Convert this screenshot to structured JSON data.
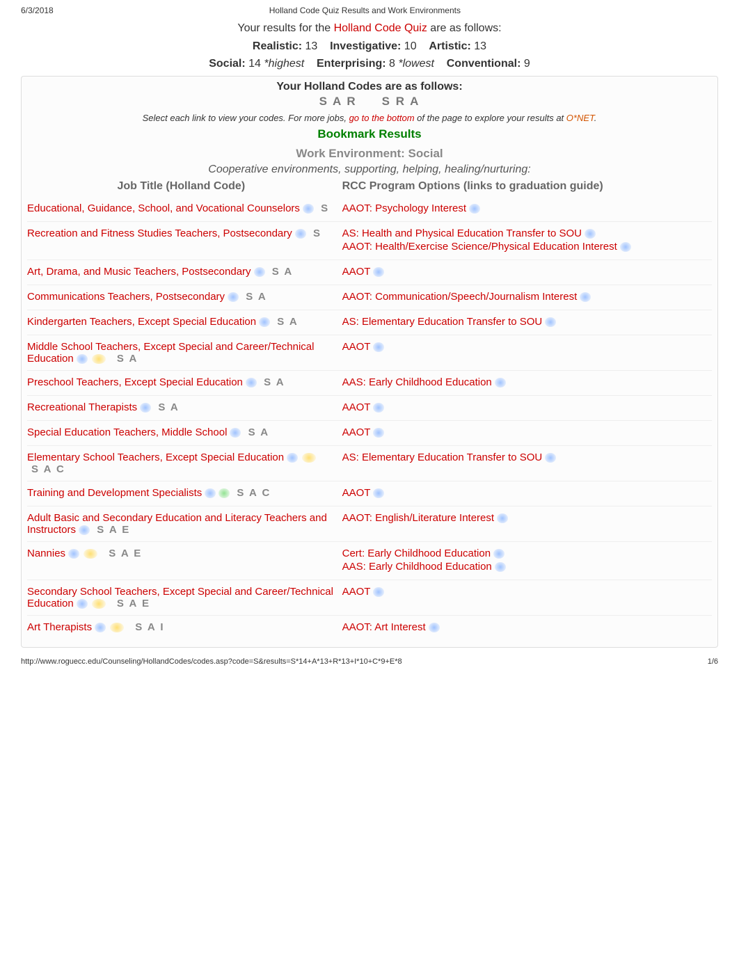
{
  "header": {
    "date": "6/3/2018",
    "title": "Holland Code Quiz Results and Work Environments"
  },
  "intro": {
    "prefix": "Your results for the ",
    "quiz_link": "Holland Code Quiz",
    "suffix": " are as follows:",
    "scores": {
      "realistic_label": "Realistic:",
      "realistic": "13",
      "investigative_label": "Investigative:",
      "investigative": "10",
      "artistic_label": "Artistic:",
      "artistic": "13",
      "social_label": "Social:",
      "social": "14",
      "social_note": "*highest",
      "enterprising_label": "Enterprising:",
      "enterprising": "8",
      "enterprising_note": "*lowest",
      "conventional_label": "Conventional:",
      "conventional": "9"
    }
  },
  "codes": {
    "title": "Your Holland Codes are as follows:",
    "code1": "S A R",
    "code2": "S R A",
    "note_pre": "Select each link to view your codes. For more jobs, ",
    "note_link": "go to the bottom",
    "note_post": " of the page to explore your results at ",
    "note_onet": "O*NET",
    "note_end": "."
  },
  "bookmark": "Bookmark Results",
  "env": {
    "title": "Work Environment: Social",
    "desc": "Cooperative environments, supporting, helping, healing/nurturing:"
  },
  "table_head": {
    "left": "Job Title (Holland Code)",
    "right": "RCC Program Options (links to graduation guide)"
  },
  "rows": [
    {
      "job": "Educational, Guidance, School, and Vocational Counselors",
      "codes": "S",
      "progs": [
        "AAOT: Psychology Interest"
      ]
    },
    {
      "job": "Recreation and Fitness Studies Teachers, Postsecondary",
      "codes": "S",
      "progs": [
        "AS: Health and Physical Education Transfer to SOU",
        "AAOT: Health/Exercise Science/Physical Education Interest"
      ]
    },
    {
      "job": "Art, Drama, and Music Teachers, Postsecondary",
      "codes": "S A",
      "progs": [
        "AAOT"
      ]
    },
    {
      "job": "Communications Teachers, Postsecondary",
      "codes": "S A",
      "progs": [
        "AAOT: Communication/Speech/Journalism Interest"
      ]
    },
    {
      "job": "Kindergarten Teachers, Except Special Education",
      "codes": "S A",
      "progs": [
        "AS: Elementary Education Transfer to SOU"
      ]
    },
    {
      "job": "Middle School Teachers, Except Special and Career/Technical Education",
      "codes": "S A",
      "progs": [
        "AAOT"
      ],
      "yellow": true
    },
    {
      "job": "Preschool Teachers, Except Special Education",
      "codes": "S A",
      "progs": [
        "AAS: Early Childhood Education"
      ]
    },
    {
      "job": "Recreational Therapists",
      "codes": "S A",
      "progs": [
        "AAOT"
      ]
    },
    {
      "job": "Special Education Teachers, Middle School",
      "codes": "S A",
      "progs": [
        "AAOT"
      ]
    },
    {
      "job": "Elementary School Teachers, Except Special Education",
      "codes": "S A C",
      "progs": [
        "AS: Elementary Education Transfer to SOU"
      ],
      "yellow": true
    },
    {
      "job": "Training and Development Specialists",
      "codes": "S A C",
      "progs": [
        "AAOT"
      ],
      "green": true
    },
    {
      "job": "Adult Basic and Secondary Education and Literacy Teachers and Instructors",
      "codes": "S A E",
      "progs": [
        "AAOT: English/Literature Interest"
      ]
    },
    {
      "job": "Nannies",
      "codes": "S A E",
      "progs": [
        "Cert: Early Childhood Education",
        "AAS: Early Childhood Education"
      ],
      "yellow": true
    },
    {
      "job": "Secondary School Teachers, Except Special and Career/Technical Education",
      "codes": "S A E",
      "progs": [
        "AAOT"
      ],
      "yellow": true
    },
    {
      "job": "Art Therapists",
      "codes": "S A  I",
      "progs": [
        "AAOT: Art Interest"
      ],
      "yellow": true
    }
  ],
  "footer": {
    "url": "http://www.roguecc.edu/Counseling/HollandCodes/codes.asp?code=S&results=S*14+A*13+R*13+I*10+C*9+E*8",
    "page": "1/6"
  }
}
